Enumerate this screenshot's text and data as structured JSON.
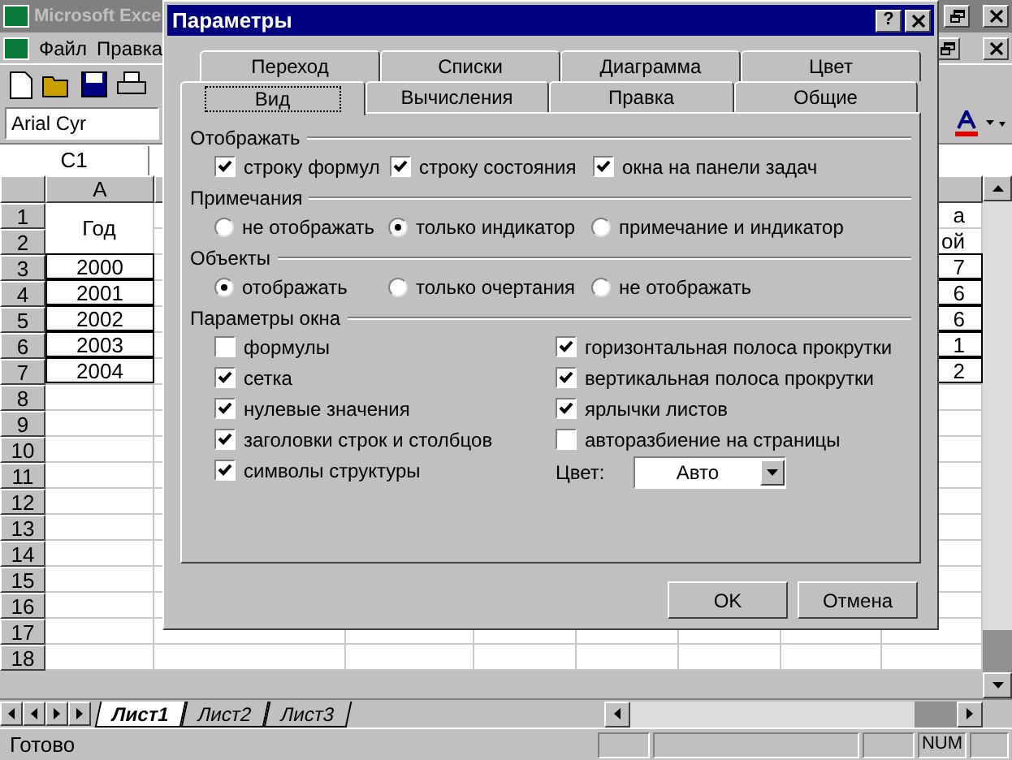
{
  "excel": {
    "title": "Microsoft Exce",
    "menu": [
      "Файл",
      "Правка"
    ],
    "font_name": "Arial Cyr",
    "name_box": "C1",
    "column_header": "A",
    "rows": [
      {
        "number": "1",
        "kind": "header",
        "a": "Год",
        "h": "а"
      },
      {
        "number": "2",
        "kind": "subheader",
        "h": "ой"
      },
      {
        "number": "3",
        "kind": "data",
        "a": "2000",
        "h": "7"
      },
      {
        "number": "4",
        "kind": "data",
        "a": "2001",
        "h": "6"
      },
      {
        "number": "5",
        "kind": "data",
        "a": "2002",
        "h": "6"
      },
      {
        "number": "6",
        "kind": "data",
        "a": "2003",
        "h": "1"
      },
      {
        "number": "7",
        "kind": "data",
        "a": "2004",
        "h": "2"
      },
      {
        "number": "8",
        "kind": "empty"
      },
      {
        "number": "9",
        "kind": "empty"
      },
      {
        "number": "10",
        "kind": "empty"
      },
      {
        "number": "11",
        "kind": "empty"
      },
      {
        "number": "12",
        "kind": "empty"
      },
      {
        "number": "13",
        "kind": "empty"
      },
      {
        "number": "14",
        "kind": "empty"
      },
      {
        "number": "15",
        "kind": "empty"
      },
      {
        "number": "16",
        "kind": "empty"
      },
      {
        "number": "17",
        "kind": "empty"
      },
      {
        "number": "18",
        "kind": "empty"
      }
    ],
    "sheet_tabs": [
      {
        "label": "Лист1",
        "selected": true
      },
      {
        "label": "Лист2",
        "selected": false
      },
      {
        "label": "Лист3",
        "selected": false
      }
    ],
    "status_bar": {
      "text": "Готово",
      "indicator": "NUM"
    }
  },
  "dialog": {
    "title": "Параметры",
    "help": "?",
    "tabs_back": [
      {
        "label": "Переход",
        "selected": false
      },
      {
        "label": "Списки",
        "selected": false
      },
      {
        "label": "Диаграмма",
        "selected": false
      },
      {
        "label": "Цвет",
        "selected": false
      }
    ],
    "tabs_front": [
      {
        "label": "Вид",
        "selected": true
      },
      {
        "label": "Вычисления",
        "selected": false
      },
      {
        "label": "Правка",
        "selected": false
      },
      {
        "label": "Общие",
        "selected": false
      }
    ],
    "show": {
      "title": "Отображать",
      "items": [
        {
          "label": "строку формул",
          "checked": true
        },
        {
          "label": "строку состояния",
          "checked": true
        },
        {
          "label": "окна на панели задач",
          "checked": true
        }
      ]
    },
    "comments": {
      "title": "Примечания",
      "options": [
        {
          "label": "не отображать",
          "selected": false
        },
        {
          "label": "только индикатор",
          "selected": true
        },
        {
          "label": "примечание и индикатор",
          "selected": false
        }
      ]
    },
    "objects": {
      "title": "Объекты",
      "options": [
        {
          "label": "отображать",
          "selected": true
        },
        {
          "label": "только очертания",
          "selected": false
        },
        {
          "label": "не отображать",
          "selected": false
        }
      ]
    },
    "window_options": {
      "title": "Параметры окна",
      "left": [
        {
          "label": "формулы",
          "checked": false
        },
        {
          "label": "сетка",
          "checked": true
        },
        {
          "label": "нулевые значения",
          "checked": true
        },
        {
          "label": "заголовки строк и столбцов",
          "checked": true
        },
        {
          "label": "символы структуры",
          "checked": true
        }
      ],
      "right": [
        {
          "label": "горизонтальная полоса прокрутки",
          "checked": true
        },
        {
          "label": "вертикальная полоса прокрутки",
          "checked": true
        },
        {
          "label": "ярлычки листов",
          "checked": true
        },
        {
          "label": "авторазбиение на страницы",
          "checked": false
        }
      ],
      "color_label": "Цвет:",
      "color_value": "Авто"
    },
    "buttons": [
      "OK",
      "Отмена"
    ]
  }
}
